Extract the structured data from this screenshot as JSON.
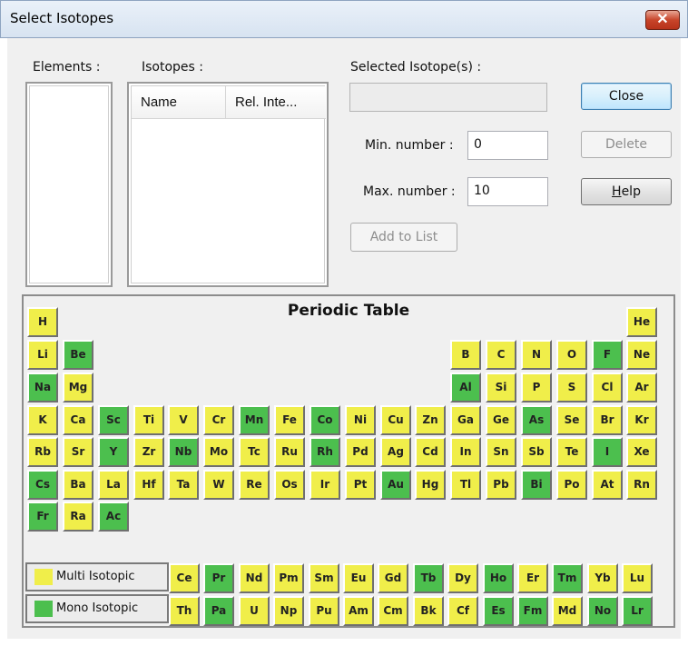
{
  "window": {
    "title": "Select Isotopes",
    "close_glyph": "✕"
  },
  "labels": {
    "elements": "Elements :",
    "isotopes": "Isotopes :",
    "selected": "Selected Isotope(s) :",
    "min_number": "Min. number :",
    "max_number": "Max. number :"
  },
  "isotopes_table": {
    "columns": [
      "Name",
      "Rel. Inte..."
    ]
  },
  "fields": {
    "min_number_value": "0",
    "max_number_value": "10",
    "selected_value": ""
  },
  "buttons": {
    "close": "Close",
    "delete": "Delete",
    "help": "Help",
    "help_mnemonic": "H",
    "add_to_list": "Add to List"
  },
  "periodic_table": {
    "title": "Periodic Table",
    "legend": {
      "multi": "Multi Isotopic",
      "mono": "Mono Isotopic"
    },
    "colors": {
      "multi": "#f0ee4a",
      "mono": "#4cbf4e"
    },
    "main_rows": [
      [
        {
          "c": 1,
          "s": "H",
          "t": "multi"
        },
        {
          "c": 18,
          "s": "He",
          "t": "multi"
        }
      ],
      [
        {
          "c": 1,
          "s": "Li",
          "t": "multi"
        },
        {
          "c": 2,
          "s": "Be",
          "t": "mono"
        },
        {
          "c": 13,
          "s": "B",
          "t": "multi"
        },
        {
          "c": 14,
          "s": "C",
          "t": "multi"
        },
        {
          "c": 15,
          "s": "N",
          "t": "multi"
        },
        {
          "c": 16,
          "s": "O",
          "t": "multi"
        },
        {
          "c": 17,
          "s": "F",
          "t": "mono"
        },
        {
          "c": 18,
          "s": "Ne",
          "t": "multi"
        }
      ],
      [
        {
          "c": 1,
          "s": "Na",
          "t": "mono"
        },
        {
          "c": 2,
          "s": "Mg",
          "t": "multi"
        },
        {
          "c": 13,
          "s": "Al",
          "t": "mono"
        },
        {
          "c": 14,
          "s": "Si",
          "t": "multi"
        },
        {
          "c": 15,
          "s": "P",
          "t": "multi"
        },
        {
          "c": 16,
          "s": "S",
          "t": "multi"
        },
        {
          "c": 17,
          "s": "Cl",
          "t": "multi"
        },
        {
          "c": 18,
          "s": "Ar",
          "t": "multi"
        }
      ],
      [
        {
          "c": 1,
          "s": "K",
          "t": "multi"
        },
        {
          "c": 2,
          "s": "Ca",
          "t": "multi"
        },
        {
          "c": 3,
          "s": "Sc",
          "t": "mono"
        },
        {
          "c": 4,
          "s": "Ti",
          "t": "multi"
        },
        {
          "c": 5,
          "s": "V",
          "t": "multi"
        },
        {
          "c": 6,
          "s": "Cr",
          "t": "multi"
        },
        {
          "c": 7,
          "s": "Mn",
          "t": "mono"
        },
        {
          "c": 8,
          "s": "Fe",
          "t": "multi"
        },
        {
          "c": 9,
          "s": "Co",
          "t": "mono"
        },
        {
          "c": 10,
          "s": "Ni",
          "t": "multi"
        },
        {
          "c": 11,
          "s": "Cu",
          "t": "multi"
        },
        {
          "c": 12,
          "s": "Zn",
          "t": "multi"
        },
        {
          "c": 13,
          "s": "Ga",
          "t": "multi"
        },
        {
          "c": 14,
          "s": "Ge",
          "t": "multi"
        },
        {
          "c": 15,
          "s": "As",
          "t": "mono"
        },
        {
          "c": 16,
          "s": "Se",
          "t": "multi"
        },
        {
          "c": 17,
          "s": "Br",
          "t": "multi"
        },
        {
          "c": 18,
          "s": "Kr",
          "t": "multi"
        }
      ],
      [
        {
          "c": 1,
          "s": "Rb",
          "t": "multi"
        },
        {
          "c": 2,
          "s": "Sr",
          "t": "multi"
        },
        {
          "c": 3,
          "s": "Y",
          "t": "mono"
        },
        {
          "c": 4,
          "s": "Zr",
          "t": "multi"
        },
        {
          "c": 5,
          "s": "Nb",
          "t": "mono"
        },
        {
          "c": 6,
          "s": "Mo",
          "t": "multi"
        },
        {
          "c": 7,
          "s": "Tc",
          "t": "multi"
        },
        {
          "c": 8,
          "s": "Ru",
          "t": "multi"
        },
        {
          "c": 9,
          "s": "Rh",
          "t": "mono"
        },
        {
          "c": 10,
          "s": "Pd",
          "t": "multi"
        },
        {
          "c": 11,
          "s": "Ag",
          "t": "multi"
        },
        {
          "c": 12,
          "s": "Cd",
          "t": "multi"
        },
        {
          "c": 13,
          "s": "In",
          "t": "multi"
        },
        {
          "c": 14,
          "s": "Sn",
          "t": "multi"
        },
        {
          "c": 15,
          "s": "Sb",
          "t": "multi"
        },
        {
          "c": 16,
          "s": "Te",
          "t": "multi"
        },
        {
          "c": 17,
          "s": "I",
          "t": "mono"
        },
        {
          "c": 18,
          "s": "Xe",
          "t": "multi"
        }
      ],
      [
        {
          "c": 1,
          "s": "Cs",
          "t": "mono"
        },
        {
          "c": 2,
          "s": "Ba",
          "t": "multi"
        },
        {
          "c": 3,
          "s": "La",
          "t": "multi"
        },
        {
          "c": 4,
          "s": "Hf",
          "t": "multi"
        },
        {
          "c": 5,
          "s": "Ta",
          "t": "multi"
        },
        {
          "c": 6,
          "s": "W",
          "t": "multi"
        },
        {
          "c": 7,
          "s": "Re",
          "t": "multi"
        },
        {
          "c": 8,
          "s": "Os",
          "t": "multi"
        },
        {
          "c": 9,
          "s": "Ir",
          "t": "multi"
        },
        {
          "c": 10,
          "s": "Pt",
          "t": "multi"
        },
        {
          "c": 11,
          "s": "Au",
          "t": "mono"
        },
        {
          "c": 12,
          "s": "Hg",
          "t": "multi"
        },
        {
          "c": 13,
          "s": "Tl",
          "t": "multi"
        },
        {
          "c": 14,
          "s": "Pb",
          "t": "multi"
        },
        {
          "c": 15,
          "s": "Bi",
          "t": "mono"
        },
        {
          "c": 16,
          "s": "Po",
          "t": "multi"
        },
        {
          "c": 17,
          "s": "At",
          "t": "multi"
        },
        {
          "c": 18,
          "s": "Rn",
          "t": "multi"
        }
      ],
      [
        {
          "c": 1,
          "s": "Fr",
          "t": "mono"
        },
        {
          "c": 2,
          "s": "Ra",
          "t": "multi"
        },
        {
          "c": 3,
          "s": "Ac",
          "t": "mono"
        }
      ]
    ],
    "f_rows": [
      [
        {
          "s": "Ce",
          "t": "multi"
        },
        {
          "s": "Pr",
          "t": "mono"
        },
        {
          "s": "Nd",
          "t": "multi"
        },
        {
          "s": "Pm",
          "t": "multi"
        },
        {
          "s": "Sm",
          "t": "multi"
        },
        {
          "s": "Eu",
          "t": "multi"
        },
        {
          "s": "Gd",
          "t": "multi"
        },
        {
          "s": "Tb",
          "t": "mono"
        },
        {
          "s": "Dy",
          "t": "multi"
        },
        {
          "s": "Ho",
          "t": "mono"
        },
        {
          "s": "Er",
          "t": "multi"
        },
        {
          "s": "Tm",
          "t": "mono"
        },
        {
          "s": "Yb",
          "t": "multi"
        },
        {
          "s": "Lu",
          "t": "multi"
        }
      ],
      [
        {
          "s": "Th",
          "t": "multi"
        },
        {
          "s": "Pa",
          "t": "mono"
        },
        {
          "s": "U",
          "t": "multi"
        },
        {
          "s": "Np",
          "t": "multi"
        },
        {
          "s": "Pu",
          "t": "multi"
        },
        {
          "s": "Am",
          "t": "multi"
        },
        {
          "s": "Cm",
          "t": "multi"
        },
        {
          "s": "Bk",
          "t": "multi"
        },
        {
          "s": "Cf",
          "t": "multi"
        },
        {
          "s": "Es",
          "t": "mono"
        },
        {
          "s": "Fm",
          "t": "mono"
        },
        {
          "s": "Md",
          "t": "multi"
        },
        {
          "s": "No",
          "t": "mono"
        },
        {
          "s": "Lr",
          "t": "mono"
        }
      ]
    ]
  }
}
